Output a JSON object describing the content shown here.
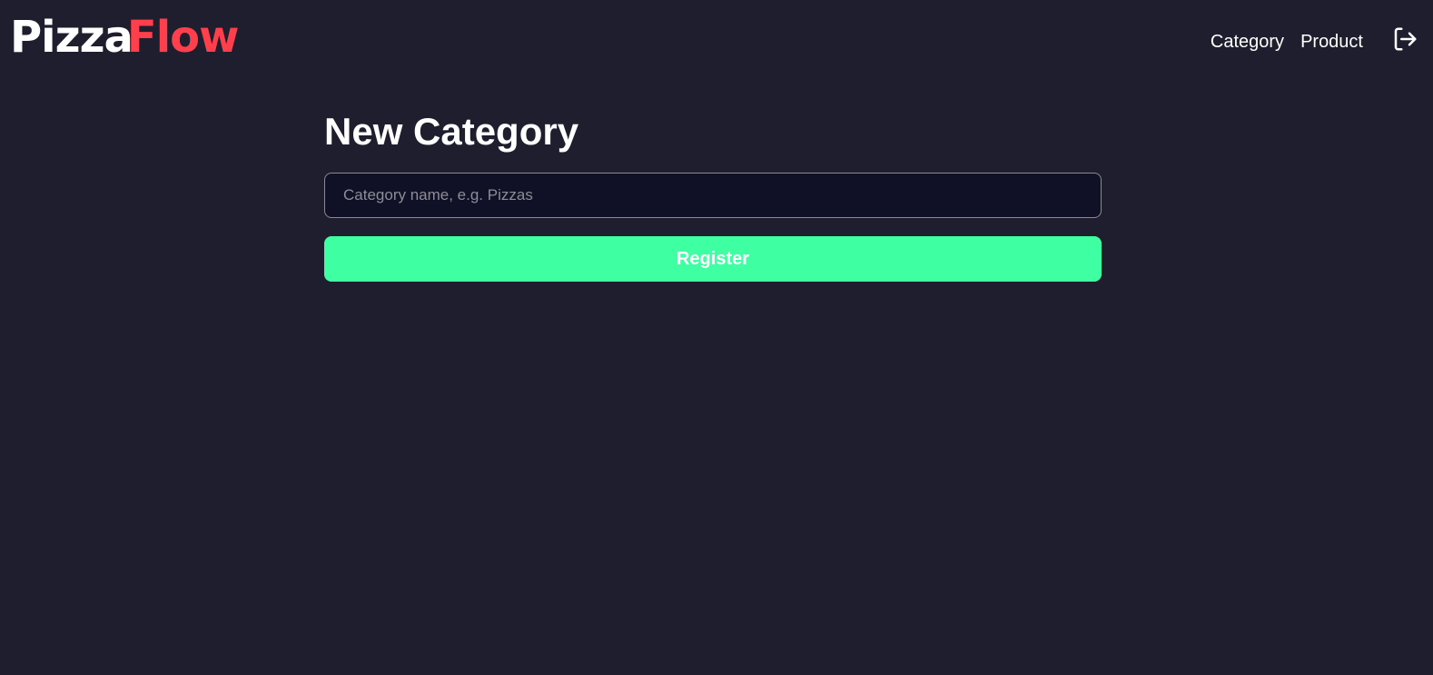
{
  "brand": {
    "part1": "Pizza",
    "part2": "Flow"
  },
  "nav": {
    "items": [
      {
        "label": "Category"
      },
      {
        "label": "Product"
      }
    ],
    "logout_icon": "logout-icon"
  },
  "form": {
    "title": "New Category",
    "name_placeholder": "Category name, e.g. Pizzas",
    "name_value": "",
    "submit_label": "Register"
  },
  "colors": {
    "background": "#1f1e2e",
    "input_background": "#101027",
    "brand_accent": "#ff3f4b",
    "button": "#3fffa3",
    "text": "#ffffff"
  }
}
